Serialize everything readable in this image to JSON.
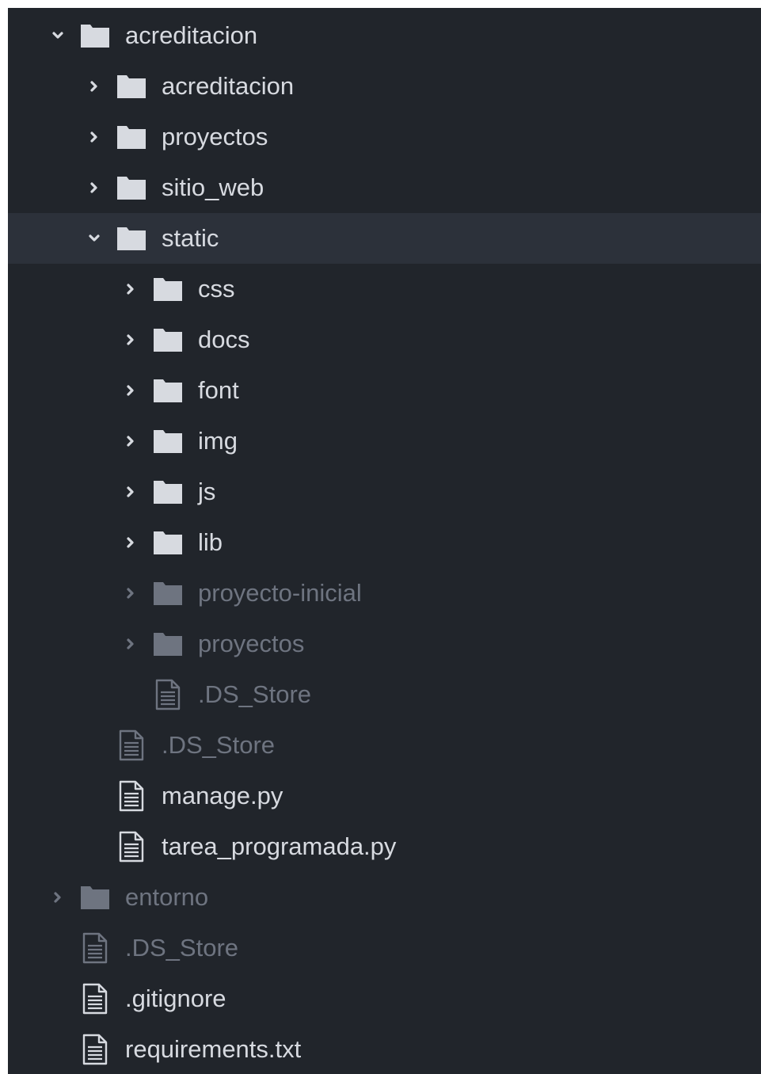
{
  "file_tree": {
    "nodes": [
      {
        "label": "acreditacion",
        "type": "folder",
        "depth": 0,
        "expanded": true,
        "dimmed": false,
        "selected": false
      },
      {
        "label": "acreditacion",
        "type": "folder",
        "depth": 1,
        "expanded": false,
        "dimmed": false,
        "selected": false
      },
      {
        "label": "proyectos",
        "type": "folder",
        "depth": 1,
        "expanded": false,
        "dimmed": false,
        "selected": false
      },
      {
        "label": "sitio_web",
        "type": "folder",
        "depth": 1,
        "expanded": false,
        "dimmed": false,
        "selected": false
      },
      {
        "label": "static",
        "type": "folder",
        "depth": 1,
        "expanded": true,
        "dimmed": false,
        "selected": true
      },
      {
        "label": "css",
        "type": "folder",
        "depth": 2,
        "expanded": false,
        "dimmed": false,
        "selected": false
      },
      {
        "label": "docs",
        "type": "folder",
        "depth": 2,
        "expanded": false,
        "dimmed": false,
        "selected": false
      },
      {
        "label": "font",
        "type": "folder",
        "depth": 2,
        "expanded": false,
        "dimmed": false,
        "selected": false
      },
      {
        "label": "img",
        "type": "folder",
        "depth": 2,
        "expanded": false,
        "dimmed": false,
        "selected": false
      },
      {
        "label": "js",
        "type": "folder",
        "depth": 2,
        "expanded": false,
        "dimmed": false,
        "selected": false
      },
      {
        "label": "lib",
        "type": "folder",
        "depth": 2,
        "expanded": false,
        "dimmed": false,
        "selected": false
      },
      {
        "label": "proyecto-inicial",
        "type": "folder",
        "depth": 2,
        "expanded": false,
        "dimmed": true,
        "selected": false
      },
      {
        "label": "proyectos",
        "type": "folder",
        "depth": 2,
        "expanded": false,
        "dimmed": true,
        "selected": false
      },
      {
        "label": ".DS_Store",
        "type": "file",
        "depth": 2,
        "dimmed": true,
        "selected": false
      },
      {
        "label": ".DS_Store",
        "type": "file",
        "depth": 1,
        "dimmed": true,
        "selected": false
      },
      {
        "label": "manage.py",
        "type": "file",
        "depth": 1,
        "dimmed": false,
        "selected": false
      },
      {
        "label": "tarea_programada.py",
        "type": "file",
        "depth": 1,
        "dimmed": false,
        "selected": false
      },
      {
        "label": "entorno",
        "type": "folder",
        "depth": 0,
        "expanded": false,
        "dimmed": true,
        "selected": false
      },
      {
        "label": ".DS_Store",
        "type": "file",
        "depth": 0,
        "dimmed": true,
        "selected": false
      },
      {
        "label": ".gitignore",
        "type": "file",
        "depth": 0,
        "dimmed": false,
        "selected": false
      },
      {
        "label": "requirements.txt",
        "type": "file",
        "depth": 0,
        "dimmed": false,
        "selected": false
      }
    ]
  },
  "colors": {
    "panel_background": "#21252b",
    "selected_row_background": "#2c313a",
    "text_bright": "#d7dae0",
    "text_dim": "#6e7480"
  }
}
